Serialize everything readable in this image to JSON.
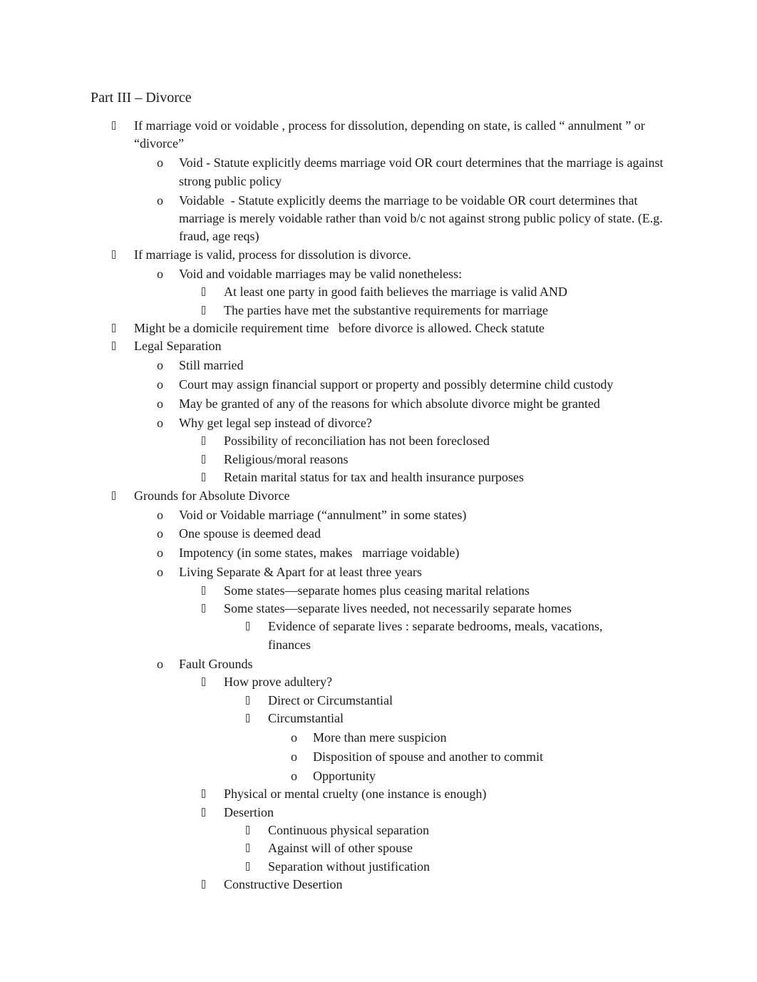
{
  "document": {
    "title": "Part III – Divorce",
    "items": [
      {
        "level": 0,
        "marker": "box",
        "text": "If marriage void or voidable , process for dissolution, depending on state, is called “ annulment ” or “divorce”"
      },
      {
        "level": 1,
        "marker": "o",
        "text": "Void - Statute explicitly deems marriage void OR court determines that the marriage is against strong public policy"
      },
      {
        "level": 1,
        "marker": "o",
        "text": "Voidable  - Statute explicitly deems the marriage to be voidable OR court determines that marriage is merely voidable rather than void b/c not against strong public policy of state. (E.g. fraud, age reqs)"
      },
      {
        "level": 0,
        "marker": "box",
        "text": "If marriage is valid, process for dissolution is divorce."
      },
      {
        "level": 1,
        "marker": "o",
        "text": "Void and voidable marriages may be valid nonetheless:"
      },
      {
        "level": 2,
        "marker": "box",
        "text": "At least one party in good faith believes the marriage is valid AND"
      },
      {
        "level": 2,
        "marker": "box",
        "text": "The parties have met the substantive requirements for marriage"
      },
      {
        "level": 0,
        "marker": "box",
        "text": "Might be a domicile requirement time   before divorce is allowed. Check statute"
      },
      {
        "level": 0,
        "marker": "box",
        "text": "Legal Separation"
      },
      {
        "level": 1,
        "marker": "o",
        "text": "Still married"
      },
      {
        "level": 1,
        "marker": "o",
        "text": "Court may assign financial support or property and possibly determine child custody"
      },
      {
        "level": 1,
        "marker": "o",
        "text": "May be granted of any of the reasons for which absolute divorce might be granted"
      },
      {
        "level": 1,
        "marker": "o",
        "text": "Why get legal sep instead of divorce?"
      },
      {
        "level": 2,
        "marker": "box",
        "text": "Possibility of reconciliation has not been foreclosed"
      },
      {
        "level": 2,
        "marker": "box",
        "text": "Religious/moral reasons"
      },
      {
        "level": 2,
        "marker": "box",
        "text": "Retain marital status for tax and health insurance purposes"
      },
      {
        "level": 0,
        "marker": "box",
        "text": "Grounds for Absolute Divorce"
      },
      {
        "level": 1,
        "marker": "o",
        "text": "Void or Voidable marriage (“annulment” in some states)"
      },
      {
        "level": 1,
        "marker": "o",
        "text": "One spouse is deemed dead"
      },
      {
        "level": 1,
        "marker": "o",
        "text": "Impotency (in some states, makes   marriage voidable)"
      },
      {
        "level": 1,
        "marker": "o",
        "text": "Living Separate & Apart for at least three years"
      },
      {
        "level": 2,
        "marker": "box",
        "text": "Some states—separate homes plus ceasing marital relations"
      },
      {
        "level": 2,
        "marker": "box",
        "text": "Some states—separate lives needed, not necessarily separate homes"
      },
      {
        "level": 3,
        "marker": "box",
        "text": "Evidence of separate lives : separate bedrooms, meals, vacations, finances"
      },
      {
        "level": 1,
        "marker": "o",
        "text": "Fault Grounds"
      },
      {
        "level": 2,
        "marker": "box",
        "text": "How prove adultery?"
      },
      {
        "level": 3,
        "marker": "box",
        "text": "Direct or Circumstantial"
      },
      {
        "level": 3,
        "marker": "box",
        "text": "Circumstantial"
      },
      {
        "level": 4,
        "marker": "o",
        "text": "More than mere suspicion"
      },
      {
        "level": 4,
        "marker": "o",
        "text": "Disposition of spouse and another to commit"
      },
      {
        "level": 4,
        "marker": "o",
        "text": "Opportunity"
      },
      {
        "level": 2,
        "marker": "box",
        "text": "Physical or mental cruelty (one instance is enough)"
      },
      {
        "level": 2,
        "marker": "box",
        "text": "Desertion"
      },
      {
        "level": 3,
        "marker": "box",
        "text": "Continuous physical separation"
      },
      {
        "level": 3,
        "marker": "box",
        "text": "Against will of other spouse"
      },
      {
        "level": 3,
        "marker": "box",
        "text": "Separation without justification"
      },
      {
        "level": 2,
        "marker": "box",
        "text": "Constructive Desertion"
      }
    ]
  }
}
